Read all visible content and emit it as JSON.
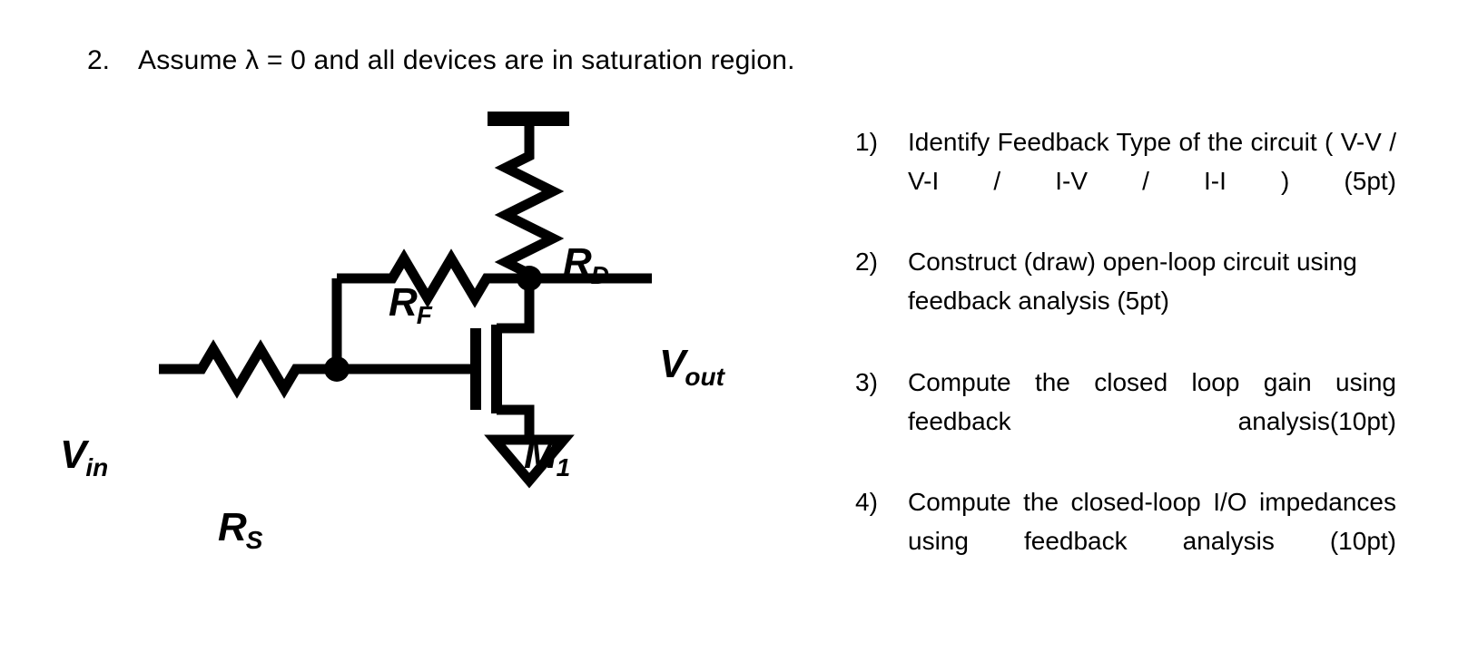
{
  "question": {
    "number": "2.",
    "text": "Assume λ = 0 and all devices are in saturation region."
  },
  "circuit": {
    "labels": {
      "rd_main": "R",
      "rd_sub": "D",
      "rf_main": "R",
      "rf_sub": "F",
      "rs_main": "R",
      "rs_sub": "S",
      "vin_main": "V",
      "vin_sub": "in",
      "vout_main": "V",
      "vout_sub": "out",
      "m1_main": "M",
      "m1_sub": "1"
    },
    "stroke_color": "#000000",
    "background_color": "#ffffff"
  },
  "tasks": [
    {
      "marker": "1)",
      "text": "Identify Feedback Type of the circuit  ( V-V / V-I / I-V / I-I ) (5pt)"
    },
    {
      "marker": "2)",
      "text": "Construct (draw) open-loop circuit using feedback analysis (5pt)"
    },
    {
      "marker": "3)",
      "text": "Compute the closed loop gain using feedback analysis(10pt)"
    },
    {
      "marker": "4)",
      "text": "Compute the closed-loop I/O impedances using feedback analysis (10pt)"
    }
  ]
}
